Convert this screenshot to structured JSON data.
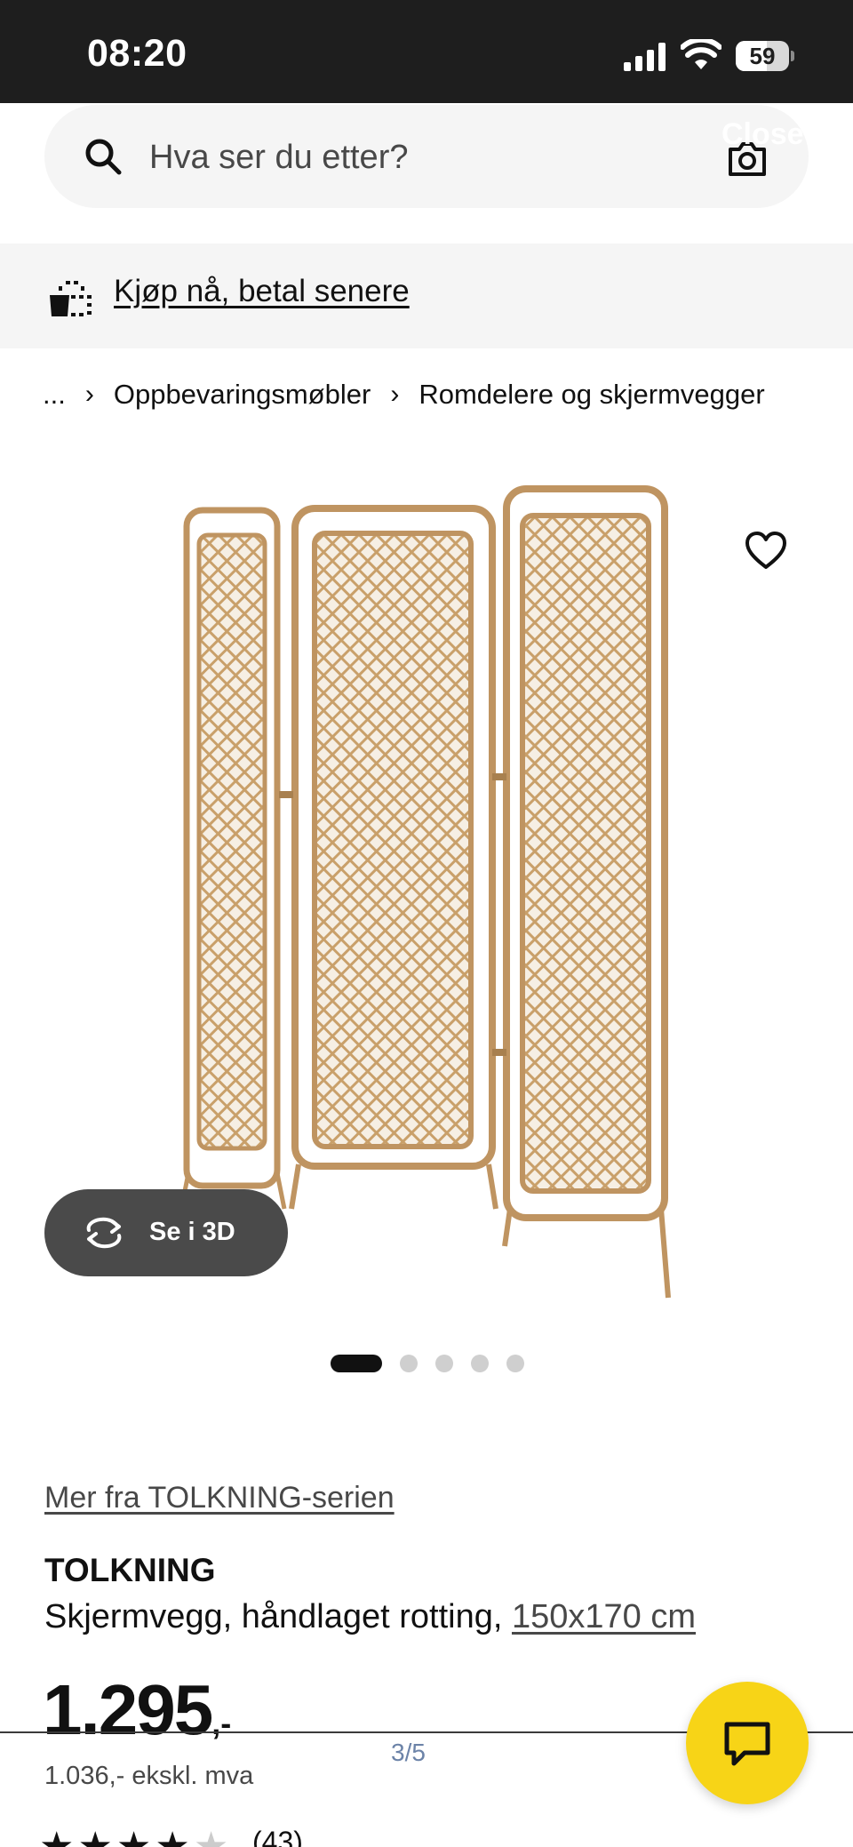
{
  "status_bar": {
    "time": "08:20",
    "battery_percent": "59",
    "battery_level": 0.59
  },
  "search": {
    "placeholder": "Hva ser du etter?",
    "overlay_text": "Close"
  },
  "promo": {
    "link_text": "Kjøp nå, betal senere"
  },
  "breadcrumb": {
    "items": [
      "...",
      "Oppbevaringsmøbler",
      "Romdelere og skjermvegger"
    ],
    "separator": "›"
  },
  "gallery": {
    "view_3d_label": "Se i 3D",
    "dot_count": 5,
    "active_index": 0
  },
  "product": {
    "series_link": "Mer fra TOLKNING-serien",
    "name": "TOLKNING",
    "description": "Skjermvegg, håndlaget rotting,",
    "dimensions": "150x170 cm",
    "price_main": "1.295",
    "price_suffix": ",-",
    "price_ex_vat": "1.036,- ekskl. mva",
    "rating": 4.5,
    "review_count": "(43)"
  },
  "page_indicator": "3/5",
  "colors": {
    "accent_yellow": "#f7d417",
    "status_bar_bg": "#1e1e1e",
    "panel_bg": "#f5f5f5",
    "rattan": "#c9a06a"
  }
}
